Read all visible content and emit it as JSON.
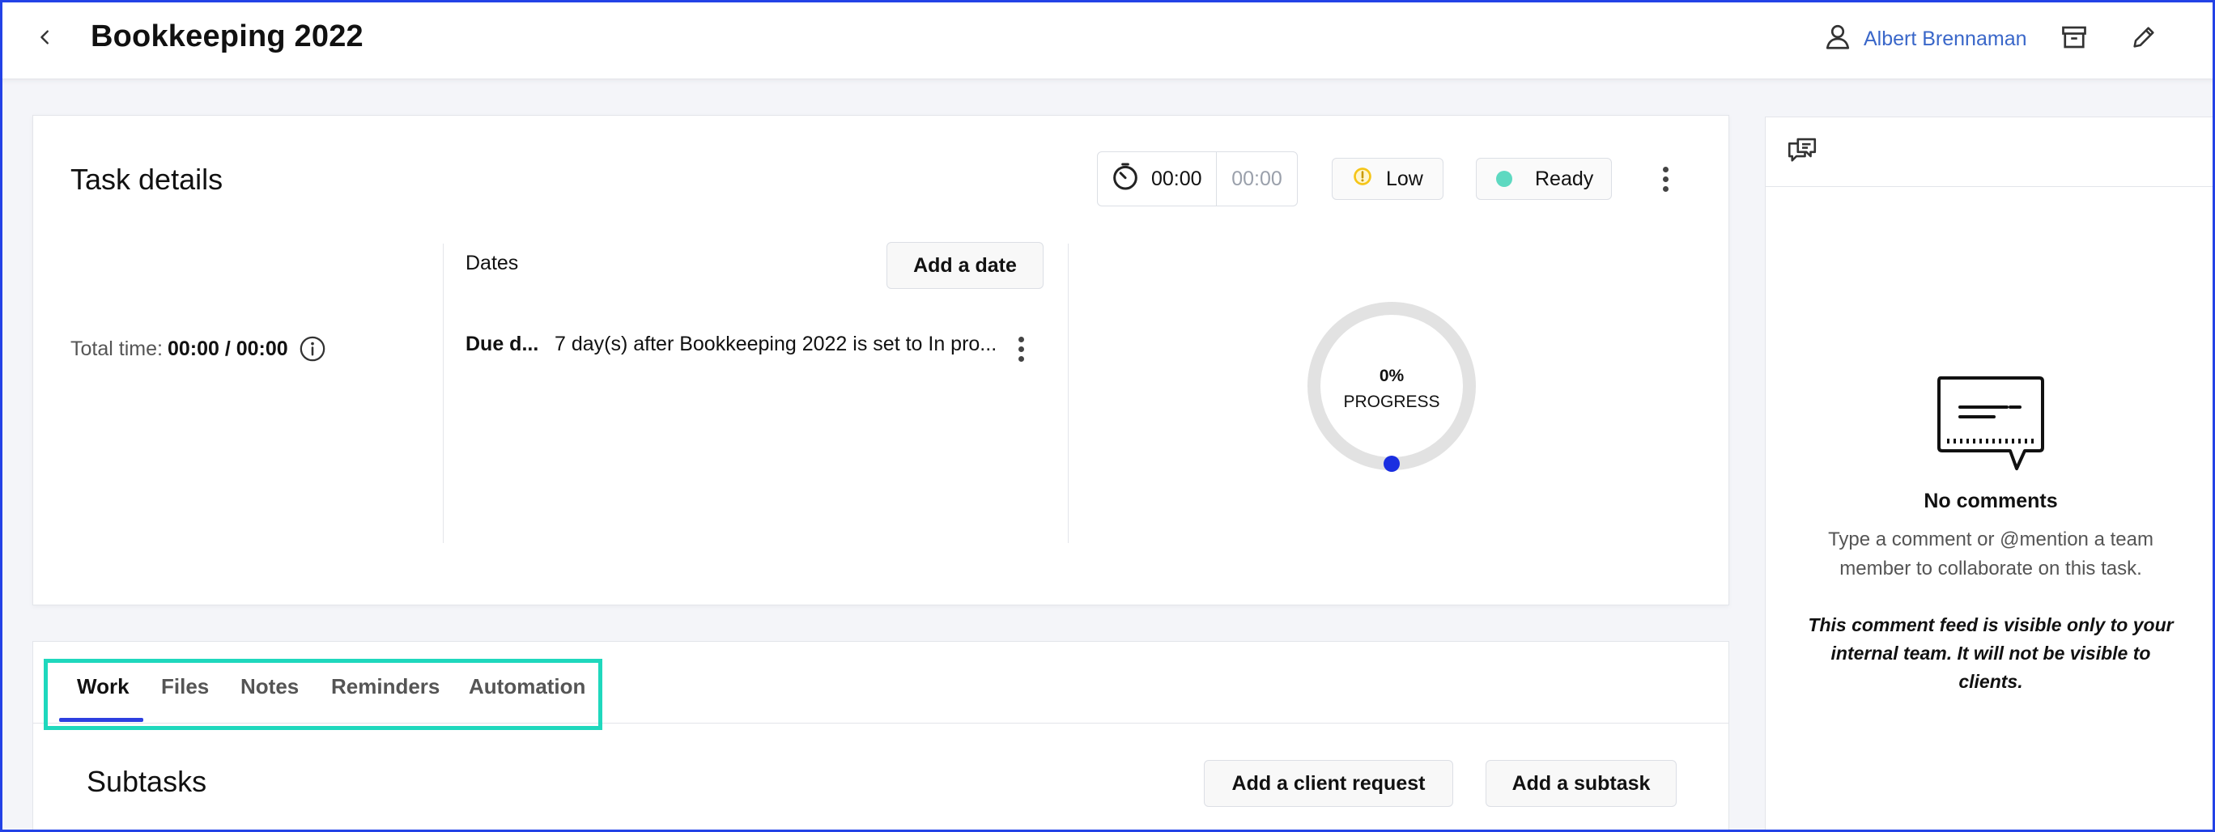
{
  "header": {
    "title": "Bookkeeping 2022",
    "user_name": "Albert Brennaman",
    "icons": [
      "chevron-left-icon",
      "user-icon",
      "archive-icon",
      "pencil-icon"
    ]
  },
  "task_details": {
    "title": "Task details",
    "timer": {
      "elapsed": "00:00",
      "estimate": "00:00"
    },
    "priority": {
      "label": "Low",
      "color": "#f5c518"
    },
    "status": {
      "label": "Ready",
      "color": "#5ed9c1"
    },
    "total_time": {
      "label": "Total time:",
      "value": "00:00 / 00:00"
    },
    "dates": {
      "label": "Dates",
      "add_button": "Add a date",
      "due": {
        "label": "Due d...",
        "text": "7 day(s) after Bookkeeping 2022 is set to In pro..."
      }
    },
    "progress": {
      "value": "0%",
      "label": "PROGRESS",
      "fraction": 0,
      "accent": "#1a2ee0"
    }
  },
  "tabs": [
    {
      "label": "Work",
      "active": true
    },
    {
      "label": "Files",
      "active": false
    },
    {
      "label": "Notes",
      "active": false
    },
    {
      "label": "Reminders",
      "active": false
    },
    {
      "label": "Automation",
      "active": false
    }
  ],
  "subtasks": {
    "title": "Subtasks",
    "client_request_button": "Add a client request",
    "subtask_button": "Add a subtask"
  },
  "comments": {
    "empty_title": "No comments",
    "empty_desc": "Type a comment or @mention a team member to collaborate on this task.",
    "visibility_note": "This comment feed is visible only to your internal team. It will not be visible to clients."
  }
}
